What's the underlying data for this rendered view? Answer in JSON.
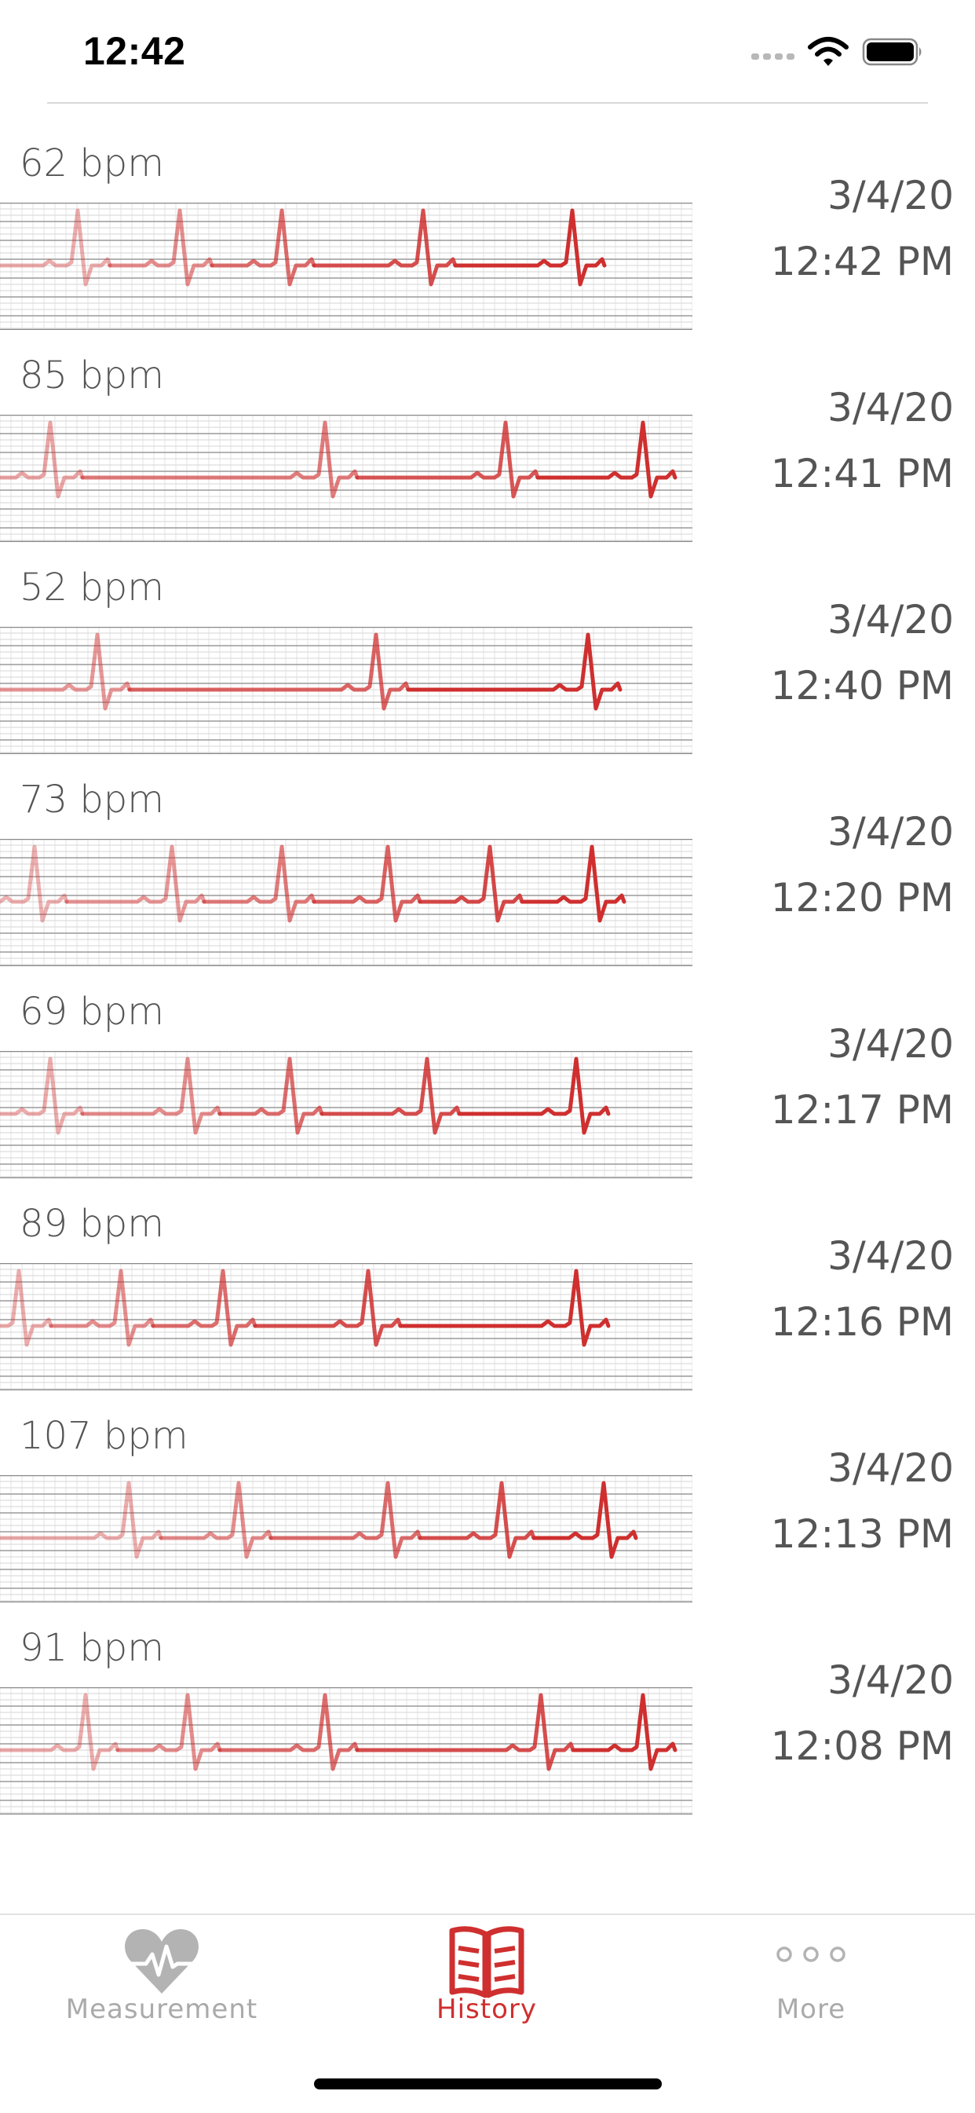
{
  "status_bar": {
    "time": "12:42"
  },
  "history": [
    {
      "bpm": "62 bpm",
      "date": "3/4/20",
      "time": "12:42 PM"
    },
    {
      "bpm": "85 bpm",
      "date": "3/4/20",
      "time": "12:41 PM"
    },
    {
      "bpm": "52 bpm",
      "date": "3/4/20",
      "time": "12:40 PM"
    },
    {
      "bpm": "73 bpm",
      "date": "3/4/20",
      "time": "12:20 PM"
    },
    {
      "bpm": "69 bpm",
      "date": "3/4/20",
      "time": "12:17 PM"
    },
    {
      "bpm": "89 bpm",
      "date": "3/4/20",
      "time": "12:16 PM"
    },
    {
      "bpm": "107 bpm",
      "date": "3/4/20",
      "time": "12:13 PM"
    },
    {
      "bpm": "91 bpm",
      "date": "3/4/20",
      "time": "12:08 PM"
    }
  ],
  "tab_bar": {
    "tabs": [
      {
        "label": "Measurement",
        "icon": "heart-pulse-icon",
        "selected": false
      },
      {
        "label": "History",
        "icon": "open-book-icon",
        "selected": true
      },
      {
        "label": "More",
        "icon": "ellipsis-icon",
        "selected": false
      }
    ]
  },
  "colors": {
    "accent": "#cf2f2f",
    "inactive": "#aaaaaa",
    "text": "#555555",
    "grid": "#bbbbbb"
  }
}
